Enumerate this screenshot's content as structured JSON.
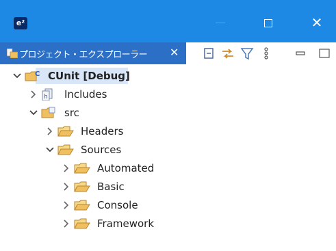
{
  "window": {
    "app_icon_text": "e²",
    "close_glyph": "✕"
  },
  "view": {
    "tab_title": "プロジェクト・エクスプローラー",
    "tab_close_glyph": "✕",
    "toolbar_icons": [
      "collapse-all-icon",
      "link-with-editor-icon",
      "filter-icon",
      "view-menu-icon",
      "minimize-icon",
      "maximize-icon"
    ]
  },
  "tree": {
    "root": {
      "label": "CUnit [Debug]",
      "expanded": true,
      "selected": true
    },
    "includes": {
      "label": "Includes",
      "expanded": false
    },
    "src": {
      "label": "src",
      "expanded": true
    },
    "headers": {
      "label": "Headers",
      "expanded": false
    },
    "sources": {
      "label": "Sources",
      "expanded": true
    },
    "automated": {
      "label": "Automated",
      "expanded": false
    },
    "basic": {
      "label": "Basic",
      "expanded": false
    },
    "console": {
      "label": "Console",
      "expanded": false
    },
    "framework": {
      "label": "Framework",
      "expanded": false
    }
  },
  "colors": {
    "titlebar": "#1e88e5",
    "active_tab": "#2b6fc6",
    "selection": "#d9e6f7",
    "folder": "#f0c060"
  }
}
